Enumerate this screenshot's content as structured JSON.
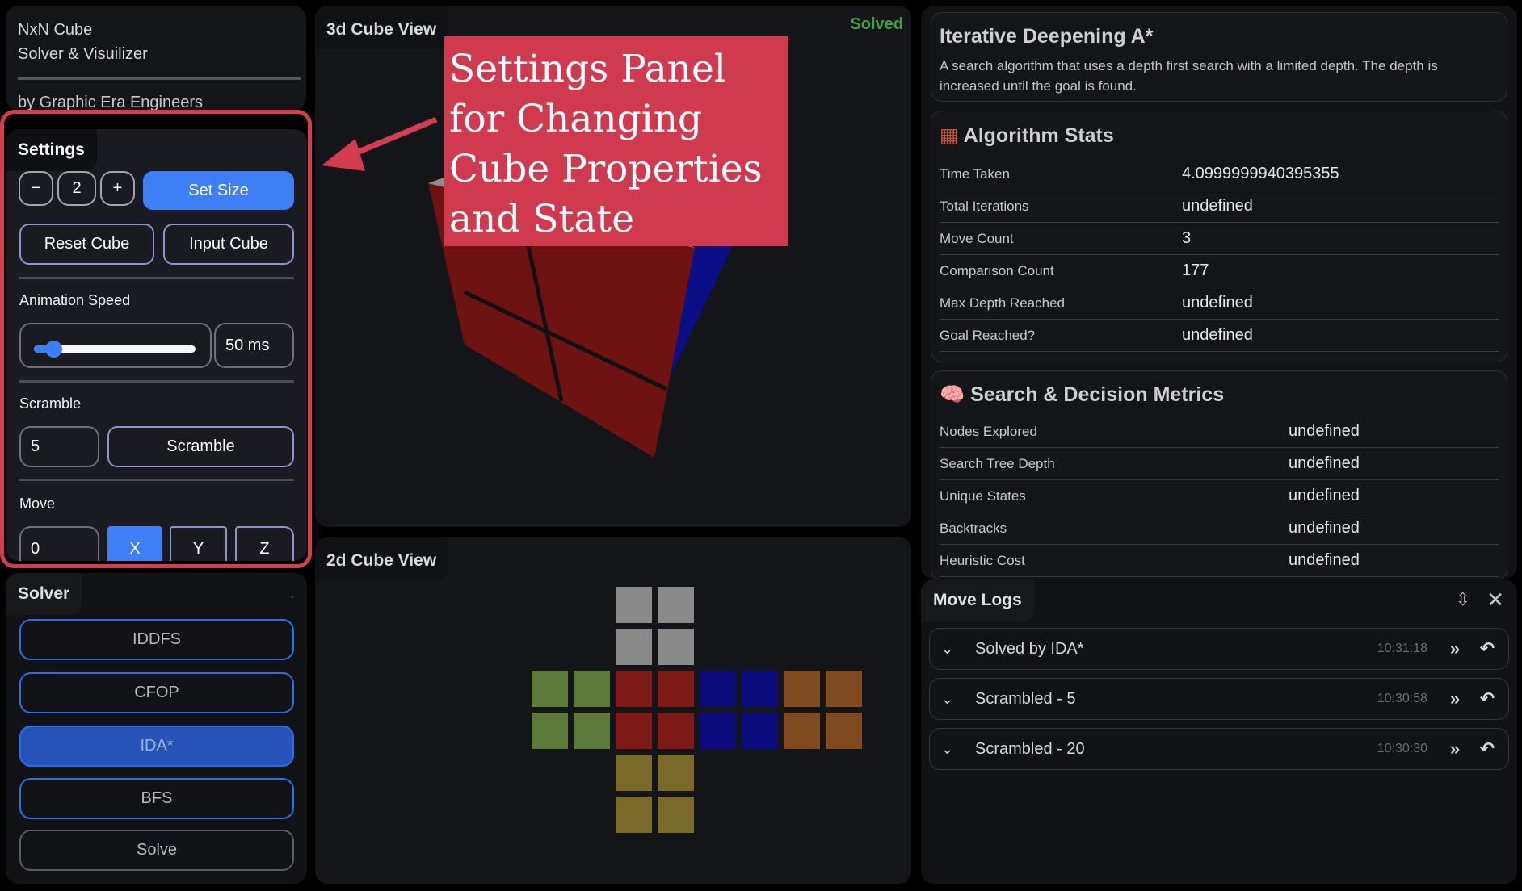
{
  "brand": {
    "title_line1": "NxN Cube",
    "title_line2": "Solver & Visuilizer",
    "byline": "by Graphic Era Engineers"
  },
  "settings": {
    "section_label": "Settings",
    "decrement": "−",
    "size_value": "2",
    "increment": "+",
    "set_size": "Set Size",
    "reset_cube": "Reset Cube",
    "input_cube": "Input Cube",
    "animation_speed_label": "Animation Speed",
    "animation_speed_value": "50 ms",
    "animation_speed_fraction": 0.12,
    "scramble_label": "Scramble",
    "scramble_count": "5",
    "scramble_button": "Scramble",
    "move_label": "Move",
    "move_value": "0",
    "axis_options": [
      "X",
      "Y",
      "Z"
    ],
    "axis_selected": "X"
  },
  "solver": {
    "section_label": "Solver",
    "dot": ".",
    "buttons": [
      "IDDFS",
      "CFOP",
      "IDA*",
      "BFS",
      "Solve"
    ],
    "active": "IDA*"
  },
  "view3d": {
    "label": "3d Cube View",
    "status": "Solved",
    "colors": {
      "front": "#6e1212",
      "side": "#0a0f88",
      "top": "#8f8f8f"
    }
  },
  "view2d": {
    "label": "2d Cube View",
    "colors": {
      "up": "#8a8a8a",
      "left": "#5b7a3a",
      "front": "#7d1a17",
      "right": "#0a0a7a",
      "back": "#7f4a1e",
      "down": "#7a6a2a"
    }
  },
  "annotation": {
    "text": "Settings Panel for Changing Cube Properties and State"
  },
  "algorithm": {
    "title": "Iterative Deepening A*",
    "description": "A search algorithm that uses a depth first search with a limited depth. The depth is increased until the goal is found."
  },
  "algorithm_stats": {
    "icon": "abacus-icon",
    "title": "Algorithm Stats",
    "rows": [
      {
        "label": "Time Taken",
        "value": "4.0999999940395355"
      },
      {
        "label": "Total Iterations",
        "value": "undefined"
      },
      {
        "label": "Move Count",
        "value": "3"
      },
      {
        "label": "Comparison Count",
        "value": "177"
      },
      {
        "label": "Max Depth Reached",
        "value": "undefined"
      },
      {
        "label": "Goal Reached?",
        "value": "undefined"
      }
    ]
  },
  "search_metrics": {
    "icon": "brain-icon",
    "title": "Search & Decision Metrics",
    "rows": [
      {
        "label": "Nodes Explored",
        "value": "undefined"
      },
      {
        "label": "Search Tree Depth",
        "value": "undefined"
      },
      {
        "label": "Unique States",
        "value": "undefined"
      },
      {
        "label": "Backtracks",
        "value": "undefined"
      },
      {
        "label": "Heuristic Cost",
        "value": "undefined"
      }
    ]
  },
  "move_logs": {
    "section_label": "Move Logs",
    "entries": [
      {
        "text": "Solved by IDA*",
        "time": "10:31:18"
      },
      {
        "text": "Scrambled - 5",
        "time": "10:30:58"
      },
      {
        "text": "Scrambled - 20",
        "time": "10:30:30"
      }
    ]
  }
}
